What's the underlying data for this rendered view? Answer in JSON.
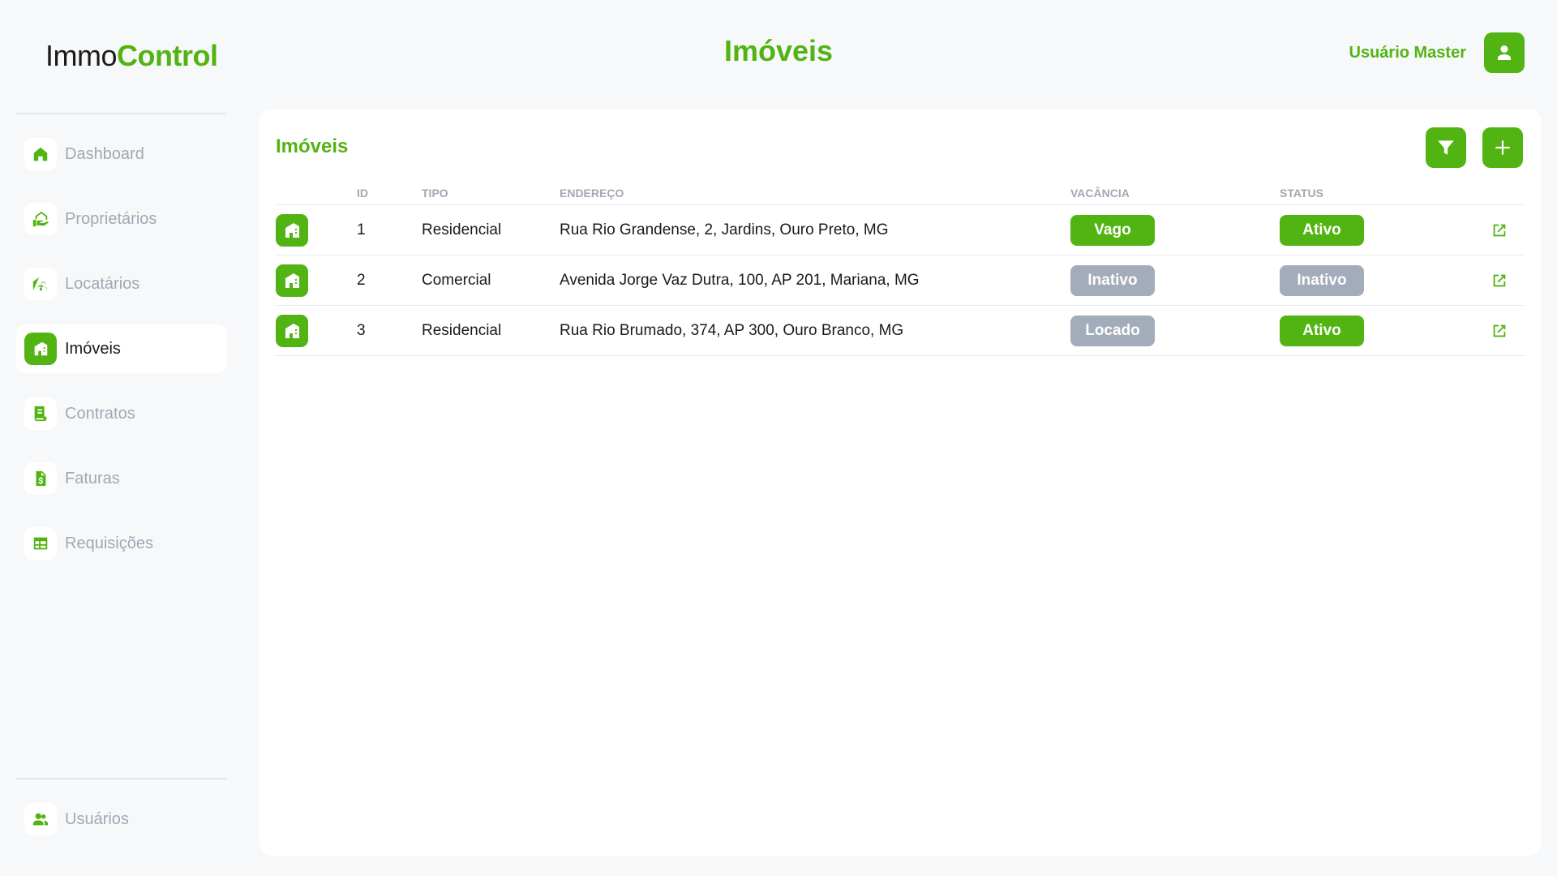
{
  "logo": {
    "part1": "Immo",
    "part2": "Control"
  },
  "header": {
    "title": "Imóveis",
    "user_name": "Usuário Master"
  },
  "sidebar": {
    "items": [
      {
        "label": "Dashboard",
        "icon": "home-icon"
      },
      {
        "label": "Proprietários",
        "icon": "owner-icon"
      },
      {
        "label": "Locatários",
        "icon": "tenant-icon"
      },
      {
        "label": "Imóveis",
        "icon": "building-icon",
        "active": true
      },
      {
        "label": "Contratos",
        "icon": "contract-icon"
      },
      {
        "label": "Faturas",
        "icon": "invoice-icon"
      },
      {
        "label": "Requisições",
        "icon": "table-icon"
      }
    ],
    "bottom": {
      "label": "Usuários",
      "icon": "users-icon"
    }
  },
  "panel": {
    "title": "Imóveis",
    "columns": [
      "ID",
      "TIPO",
      "ENDEREÇO",
      "VACÂNCIA",
      "STATUS"
    ],
    "rows": [
      {
        "id": "1",
        "tipo": "Residencial",
        "endereco": "Rua Rio Grandense, 2, Jardins, Ouro Preto, MG",
        "vacancia": "Vago",
        "status": "Ativo"
      },
      {
        "id": "2",
        "tipo": "Comercial",
        "endereco": "Avenida Jorge Vaz Dutra, 100, AP 201, Mariana, MG",
        "vacancia": "Inativo",
        "status": "Inativo"
      },
      {
        "id": "3",
        "tipo": "Residencial",
        "endereco": "Rua Rio Brumado, 374, AP 300, Ouro Branco, MG",
        "vacancia": "Locado",
        "status": "Ativo"
      }
    ]
  },
  "colors": {
    "accent": "#52b412",
    "muted": "#a3acba",
    "background": "#f7f8fa"
  }
}
